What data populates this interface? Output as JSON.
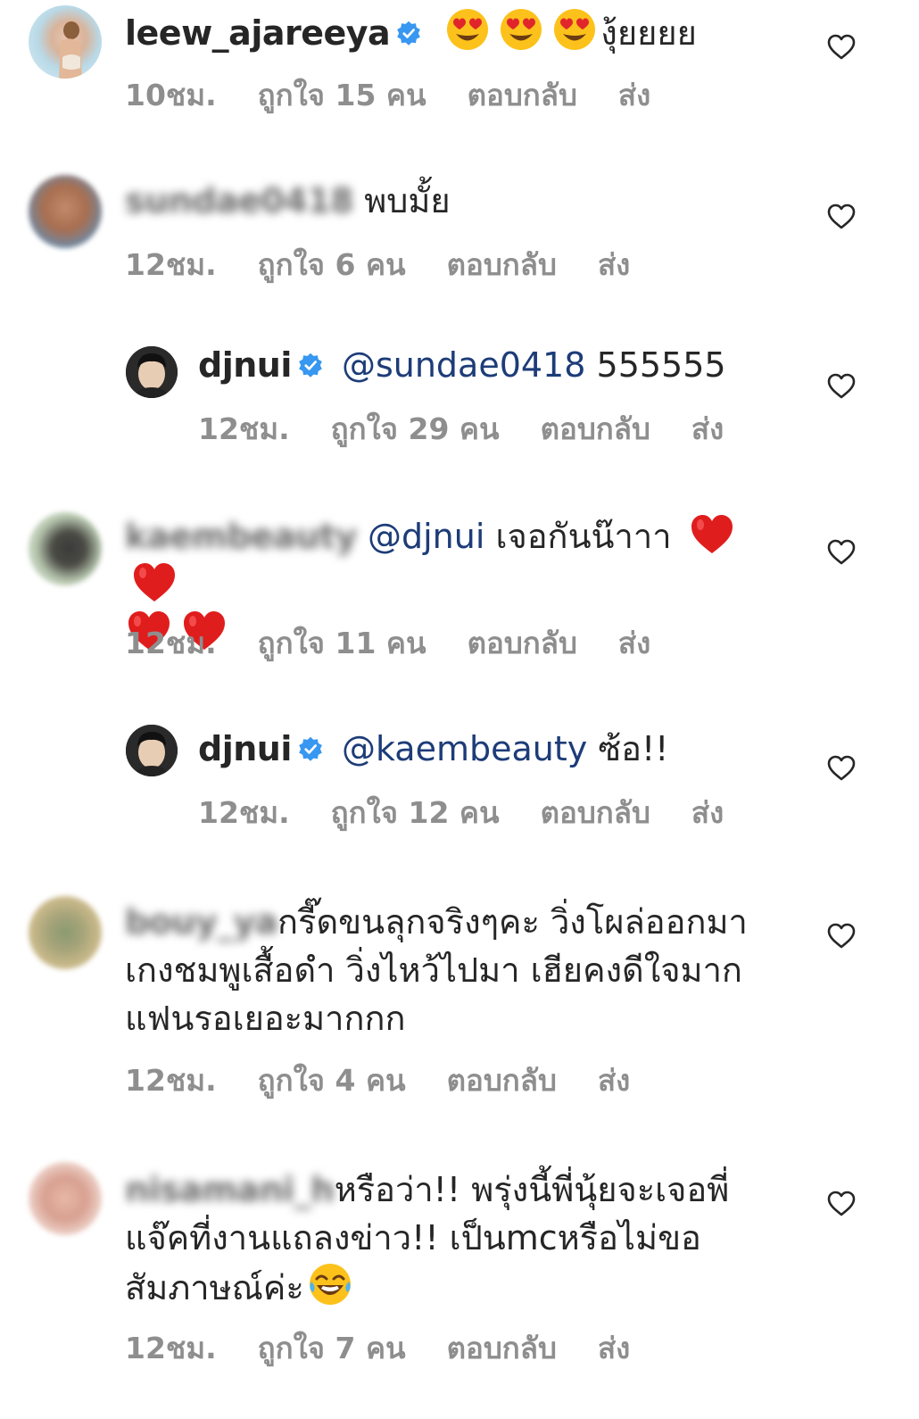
{
  "actions": {
    "reply_label": "ตอบกลับ",
    "send_label": "ส่ง"
  },
  "comments": [
    {
      "username": "leew_ajareeya",
      "text": "งุ้ยยยย",
      "time": "10ชม.",
      "likes": "ถูกใจ 15 คน"
    },
    {
      "username": "sundae0418",
      "text": "พบมั้ย",
      "time": "12ชม.",
      "likes": "ถูกใจ 6 คน"
    },
    {
      "username": "djnui",
      "mention": "@sundae0418",
      "text": "555555",
      "time": "12ชม.",
      "likes": "ถูกใจ 29 คน"
    },
    {
      "username": "kaembeauty",
      "mention": "@djnui",
      "text": "เจอกันน๊าาา",
      "time": "12ชม.",
      "likes": "ถูกใจ 11 คน"
    },
    {
      "username": "djnui",
      "mention": "@kaembeauty",
      "text": "ซ้อ!!",
      "time": "12ชม.",
      "likes": "ถูกใจ 12 คน"
    },
    {
      "username": "bouy_ya",
      "text": "กรี๊ดขนลุกจริงๆคะ วิ่งโผล่ออกมา",
      "text2": "เกงชมพูเสื้อดำ วิ่งไหว้ไปมา เฮียคงดีใจมาก",
      "text3": "แฟนรอเยอะมากกก",
      "time": "12ชม.",
      "likes": "ถูกใจ 4 คน"
    },
    {
      "username": "nisamani_h",
      "text": "หรือว่า!! พรุ่งนี้พี่นุ้ยจะเจอพี่",
      "text2": "แจ๊คที่งานแถลงข่าว!! เป็นmcหรือไม่ขอ",
      "text3": "สัมภาษณ์ค่ะ",
      "time": "12ชม.",
      "likes": "ถูกใจ 7 คน"
    }
  ],
  "colors": {
    "meta": "#8e8e8e",
    "mention": "#1d3c78",
    "verified": "#3897f0"
  }
}
